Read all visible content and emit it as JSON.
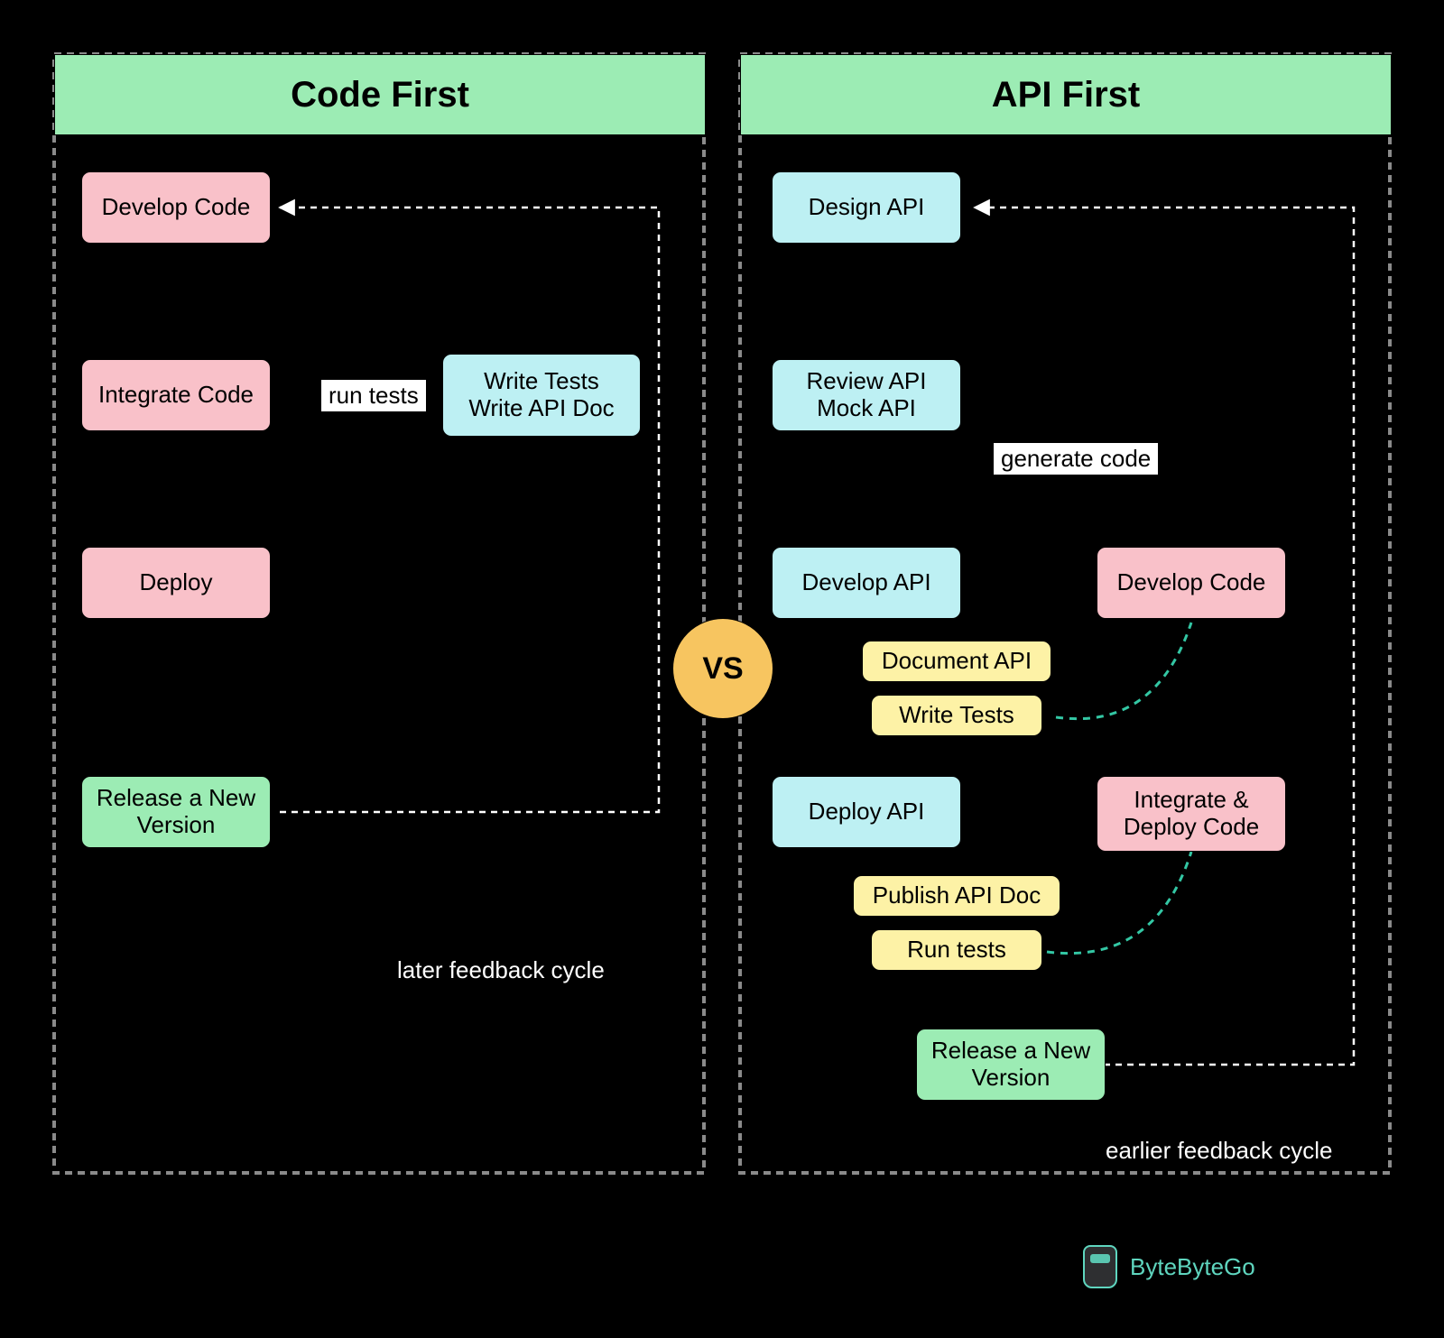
{
  "diagram": {
    "left_title": "Code First",
    "right_title": "API First",
    "vs": "VS",
    "left": {
      "n1": "Develop Code",
      "n2": "Integrate Code",
      "n2b": "Write Tests\nWrite API Doc",
      "n3": "Deploy",
      "n4": "Release a New\nVersion",
      "edge_run_tests": "run tests",
      "feedback": "later feedback cycle"
    },
    "right": {
      "n1": "Design API",
      "n2": "Review API\nMock API",
      "n3": "Develop API",
      "n3r": "Develop Code",
      "n3a": "Document API",
      "n3b": "Write Tests",
      "n4": "Deploy API",
      "n4r": "Integrate &\nDeploy Code",
      "n4a": "Publish API Doc",
      "n4b": "Run tests",
      "n5": "Release a New\nVersion",
      "edge_generate_code": "generate code",
      "feedback": "earlier feedback cycle"
    },
    "footer": "ByteByteGo"
  },
  "colors": {
    "pink": "#f9c1c9",
    "blue": "#bdf0f3",
    "green": "#9cecb4",
    "yellow": "#fdf2a6",
    "accent": "#f7c560",
    "teal": "#33c7a4"
  }
}
